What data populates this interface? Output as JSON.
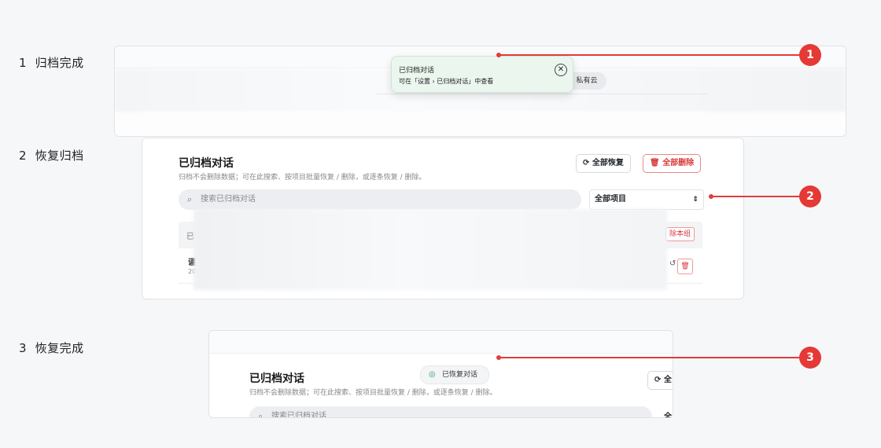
{
  "steps": [
    {
      "number": "1",
      "label": "归档完成"
    },
    {
      "number": "2",
      "label": "恢复归档"
    },
    {
      "number": "3",
      "label": "恢复完成"
    }
  ],
  "step1": {
    "toast_title": "已归档对话",
    "toast_body": "可在「设置 › 已归档对话」中查看",
    "chip_label": "私有云"
  },
  "step2": {
    "title": "已归档对话",
    "subtitle": "归档不会删除数据；可在此搜索、按项目批量恢复 / 删除，或逐条恢复 / 删除。",
    "restore_all_label": "全部恢复",
    "delete_all_label": "全部删除",
    "search_placeholder": "搜索已归档对话",
    "project_select_value": "全部项目",
    "group_header_fragment": "已",
    "group_action_fragment": "除本组",
    "row_title_fragment": "谨",
    "row_meta_fragment": "20"
  },
  "step3": {
    "toast_label": "已恢复对话",
    "title": "已归档对话",
    "subtitle": "归档不会删除数据；可在此搜索、按项目批量恢复 / 删除，或逐条恢复 / 删除。",
    "restore_all_fragment": "全",
    "search_placeholder": "搜索已归档对话",
    "select_fragment": "全"
  },
  "callouts": [
    "1",
    "2",
    "3"
  ],
  "colors": {
    "accent_red": "#e53935",
    "toast_green_bg": "#eaf6ee",
    "danger_text": "#d63b3b"
  },
  "icons": {
    "search": "search-icon",
    "refresh": "refresh-icon",
    "trash": "trash-icon",
    "close": "close-icon",
    "check_circle": "check-circle-icon",
    "select_arrows": "select-arrows-icon"
  }
}
